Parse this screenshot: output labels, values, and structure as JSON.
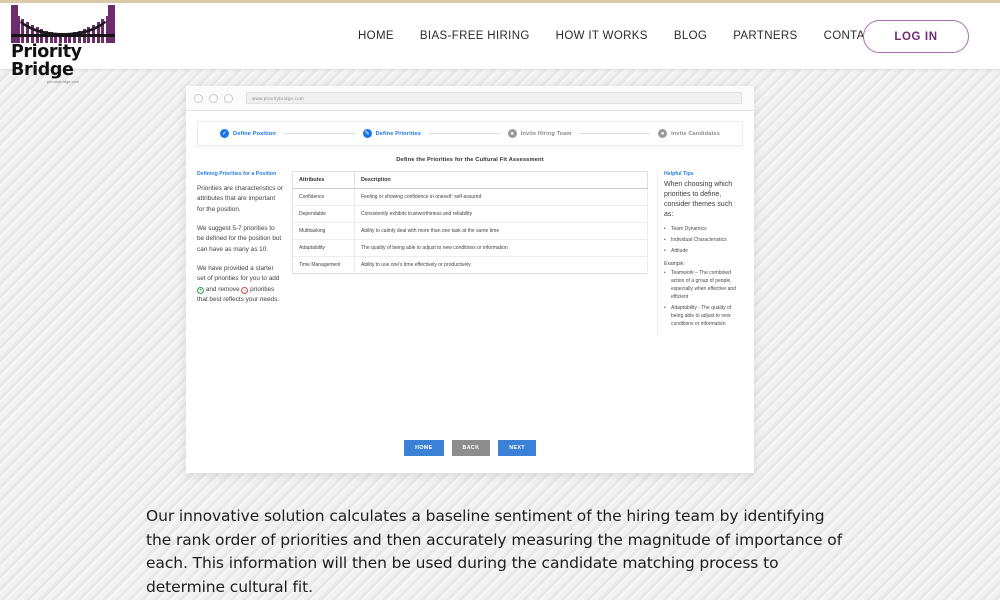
{
  "header": {
    "logo": {
      "word": "Priority Bridge",
      "url": "prioritybridge.com"
    },
    "nav": [
      {
        "label": "HOME"
      },
      {
        "label": "BIAS-FREE HIRING"
      },
      {
        "label": "HOW IT WORKS"
      },
      {
        "label": "BLOG"
      },
      {
        "label": "PARTNERS"
      },
      {
        "label": "CONTACT"
      }
    ],
    "login_label": "LOG IN"
  },
  "browser": {
    "url": "www.prioritybridge.com",
    "dots": 3
  },
  "wizard": {
    "steps": [
      {
        "label": "Define Position",
        "state": "done",
        "icon": "check-icon"
      },
      {
        "label": "Define Priorities",
        "state": "active",
        "icon": "pencil-icon"
      },
      {
        "label": "Invite Hiring Team",
        "state": "pending",
        "icon": "circle-icon"
      },
      {
        "label": "Invite Candidates",
        "state": "pending",
        "icon": "circle-icon"
      }
    ],
    "title": "Define the Priorities for the Cultural Fit Assessment",
    "buttons": [
      {
        "label": "HOME",
        "style": "primary"
      },
      {
        "label": "BACK",
        "style": "gray"
      },
      {
        "label": "NEXT",
        "style": "primary"
      }
    ]
  },
  "left_panel": {
    "heading": "Defining Priorities for a Position",
    "para1": "Priorities are characteristics or attributes that are important for the position.",
    "para2": "We suggest 5-7 priorities to be defined for the position but can have as many as 10.",
    "para3_before": "We have provided a starter set of priorities for you to add",
    "para3_mid": "and remove",
    "para3_after": "priorities that best reflects your needs.",
    "add_icon_label": "+",
    "remove_icon_label": "−"
  },
  "table": {
    "columns": [
      "Attributes",
      "Description"
    ],
    "rows": [
      {
        "attribute": "Confidence",
        "description": "Feeling or showing confidence in oneself; self-assured"
      },
      {
        "attribute": "Dependable",
        "description": "Consistently exhibits trustworthiness and reliability"
      },
      {
        "attribute": "Multitasking",
        "description": "Ability to calmly deal with more than one task at the same time"
      },
      {
        "attribute": "Adaptability",
        "description": "The quality of being able to adjust to new conditions or information"
      },
      {
        "attribute": "Time Management",
        "description": "Ability to use one's time effectively or productively"
      }
    ]
  },
  "right_panel": {
    "heading": "Helpful Tips",
    "intro": "When choosing which priorities to define, consider themes such as:",
    "themes": [
      "Team Dynamics",
      "Individual Characteristics",
      "Attitude"
    ],
    "example_title": "Example:",
    "examples": [
      "Teamwork – The combined action of a group of people, especially when effective and efficient",
      "Adaptability - The quality of being able to adjust to new conditions or information"
    ]
  },
  "bottom": {
    "paragraph": "Our innovative solution calculates a baseline sentiment of the hiring team by identifying the rank order of priorities and then accurately measuring the magnitude of importance of each. This information will then be used during the candidate matching process to determine cultural fit."
  },
  "colors": {
    "accent_purple": "#6f2d76",
    "step_blue": "#1a73e8",
    "button_blue": "#3b82d6",
    "button_gray": "#8d8d8d",
    "top_bar": "#d9c9a8",
    "add_green": "#2e9e4f",
    "remove_red": "#d94b4b"
  }
}
